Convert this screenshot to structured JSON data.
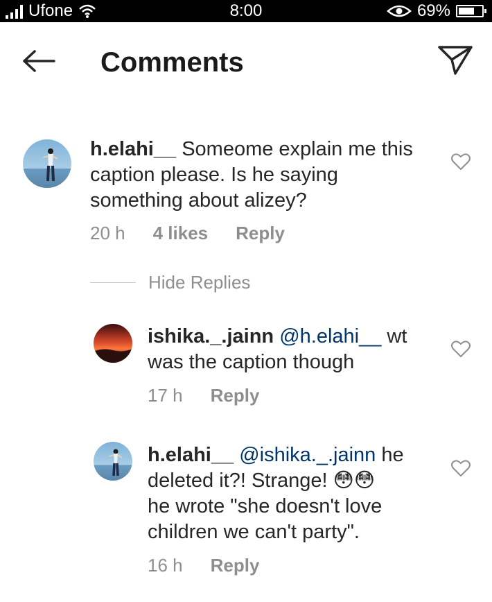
{
  "status_bar": {
    "carrier": "Ufone",
    "time": "8:00",
    "battery": "69%",
    "battery_level": 0.69
  },
  "header": {
    "title": "Comments",
    "back_icon": "arrow-left-icon",
    "share_icon": "paper-plane-icon"
  },
  "comments": [
    {
      "username": "h.elahi__",
      "text": "Someome explain me this caption please. Is he saying something about alizey?",
      "time": "20 h",
      "likes": "4 likes",
      "reply_label": "Reply"
    }
  ],
  "hide_replies_label": "Hide Replies",
  "replies": [
    {
      "username": "ishika._.jainn",
      "mention": "@h.elahi__",
      "text": "wt was the caption though",
      "time": "17 h",
      "reply_label": "Reply"
    },
    {
      "username": "h.elahi__",
      "mention": "@ishika._.jainn",
      "text_line1": "he deleted it?! Strange!",
      "emojis": "😳😳",
      "text_line2": "he wrote \"she doesn't love children we can't party\".",
      "time": "16 h",
      "reply_label": "Reply"
    }
  ]
}
